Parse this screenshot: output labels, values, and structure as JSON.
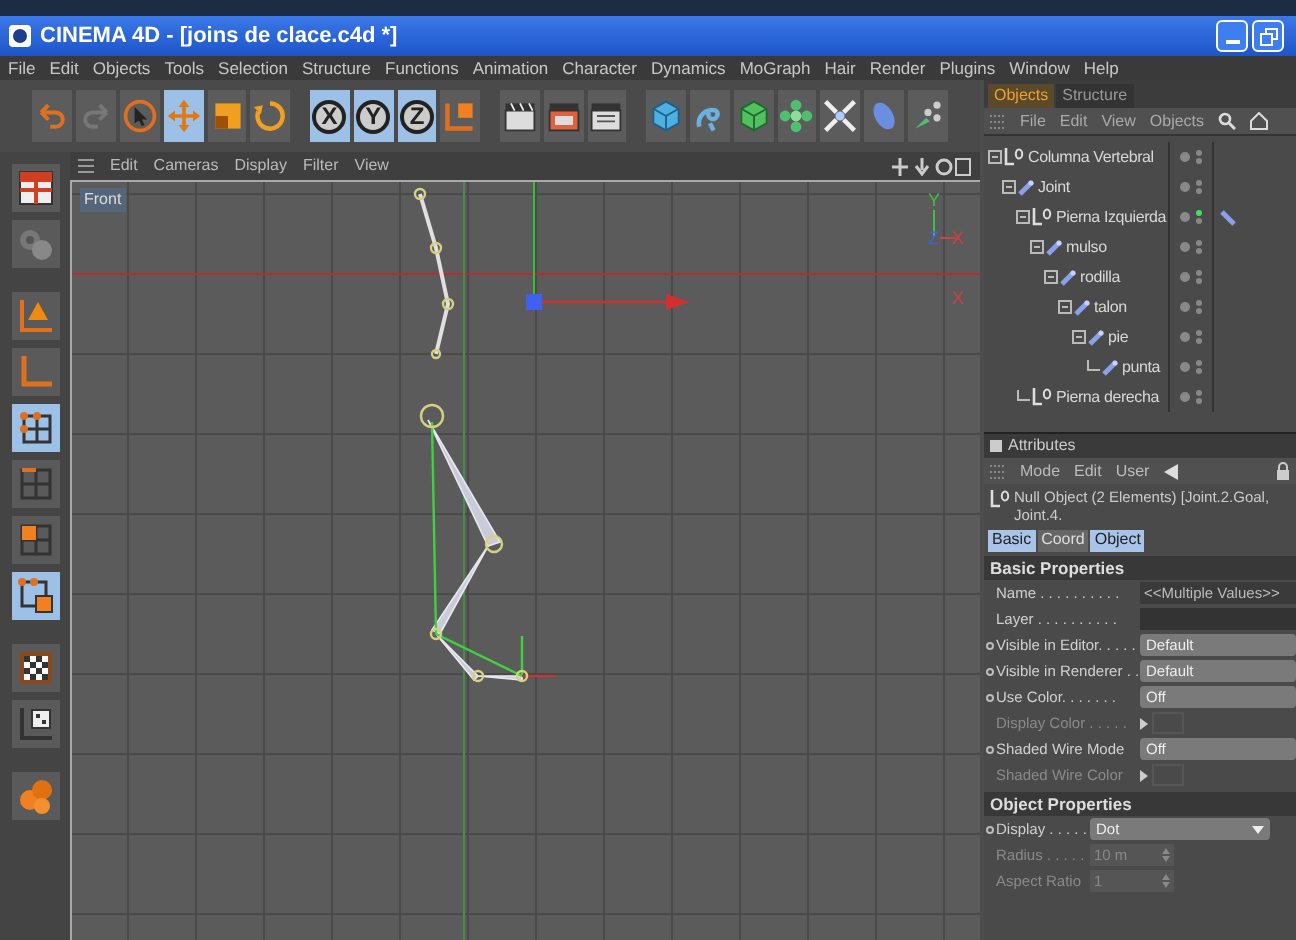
{
  "window": {
    "title": "CINEMA 4D - [joins de clace.c4d *]"
  },
  "menu_bar": [
    "File",
    "Edit",
    "Objects",
    "Tools",
    "Selection",
    "Structure",
    "Functions",
    "Animation",
    "Character",
    "Dynamics",
    "MoGraph",
    "Hair",
    "Render",
    "Plugins",
    "Window",
    "Help"
  ],
  "toolbar": [
    {
      "kind": "undo",
      "selected": false
    },
    {
      "kind": "redo",
      "selected": false
    },
    {
      "kind": "live-select",
      "selected": false
    },
    {
      "kind": "move",
      "selected": true
    },
    {
      "kind": "scale",
      "selected": false
    },
    {
      "kind": "rotate",
      "selected": false
    },
    {
      "kind": "axis",
      "label": "X",
      "selected": true
    },
    {
      "kind": "axis",
      "label": "Y",
      "selected": true
    },
    {
      "kind": "axis",
      "label": "Z",
      "selected": true
    },
    {
      "kind": "coord",
      "selected": false
    },
    {
      "kind": "render-view",
      "selected": false
    },
    {
      "kind": "render-active",
      "selected": false
    },
    {
      "kind": "render-settings",
      "selected": false
    },
    {
      "kind": "cube",
      "selected": false
    },
    {
      "kind": "spline",
      "selected": false
    },
    {
      "kind": "nurbs",
      "selected": false
    },
    {
      "kind": "array",
      "selected": false
    },
    {
      "kind": "deformer",
      "selected": false
    },
    {
      "kind": "light",
      "selected": false
    },
    {
      "kind": "particles",
      "selected": false
    }
  ],
  "left_toolbar": [
    {
      "kind": "layout",
      "selected": false
    },
    {
      "kind": "gear",
      "selected": false
    },
    {
      "kind": "object-axis",
      "selected": false
    },
    {
      "kind": "axis",
      "selected": false
    },
    {
      "kind": "points",
      "selected": true
    },
    {
      "kind": "edges",
      "selected": false
    },
    {
      "kind": "polygons",
      "selected": false
    },
    {
      "kind": "uv",
      "selected": true
    },
    {
      "kind": "texture",
      "selected": false
    },
    {
      "kind": "texture-axis",
      "selected": false
    },
    {
      "kind": "sculpt",
      "selected": false
    }
  ],
  "viewport": {
    "menu": [
      "Edit",
      "Cameras",
      "Display",
      "Filter",
      "View"
    ],
    "camera": "Front",
    "axis_labels": [
      "Y",
      "Z",
      "X",
      "X"
    ]
  },
  "objects_panel": {
    "tabs": [
      {
        "label": "Objects",
        "selected": true
      },
      {
        "label": "Structure",
        "selected": false
      }
    ],
    "menu": [
      "File",
      "Edit",
      "View",
      "Objects"
    ],
    "tree": [
      {
        "name": "Columna Vertebral",
        "kind": "null",
        "active": false,
        "tagged": false,
        "children": [
          {
            "name": "Joint",
            "kind": "joint",
            "active": false,
            "tagged": false,
            "children": [
              {
                "name": "Pierna Izquierda",
                "kind": "null",
                "active": true,
                "tagged": true,
                "children": [
                  {
                    "name": "mulso",
                    "kind": "joint",
                    "active": false,
                    "tagged": false,
                    "children": [
                      {
                        "name": "rodilla",
                        "kind": "joint",
                        "active": false,
                        "tagged": false,
                        "children": [
                          {
                            "name": "talon",
                            "kind": "joint",
                            "active": false,
                            "tagged": false,
                            "children": [
                              {
                                "name": "pie",
                                "kind": "joint",
                                "active": false,
                                "tagged": false,
                                "children": [
                                  {
                                    "name": "punta",
                                    "kind": "joint",
                                    "active": false,
                                    "tagged": false
                                  }
                                ]
                              }
                            ]
                          }
                        ]
                      }
                    ]
                  }
                ]
              },
              {
                "name": "Pierna derecha",
                "kind": "null",
                "active": false,
                "tagged": false
              }
            ]
          }
        ]
      }
    ]
  },
  "attributes": {
    "title": "Attributes",
    "menu": [
      "Mode",
      "Edit",
      "User"
    ],
    "object": "Null Object (2 Elements) [Joint.2.Goal, Joint.4.",
    "tabs": [
      {
        "label": "Basic",
        "selected": true
      },
      {
        "label": "Coord",
        "selected": false
      },
      {
        "label": "Object",
        "selected": true
      }
    ],
    "sections": [
      {
        "title": "Basic Properties",
        "rows": [
          {
            "label": "Name . . . . . . . . . .",
            "kind": "text",
            "value": "<<Multiple Values>>",
            "disabled": false,
            "keyed": false
          },
          {
            "label": "Layer . . . . . . . . . .",
            "kind": "link",
            "disabled": false,
            "keyed": false
          },
          {
            "label": "Visible in Editor. . . . .",
            "kind": "cycle",
            "value": "Default",
            "disabled": false,
            "keyed": true
          },
          {
            "label": "Visible in Renderer . .",
            "kind": "cycle",
            "value": "Default",
            "disabled": false,
            "keyed": true
          },
          {
            "label": "Use Color. . . . . . .",
            "kind": "cycle",
            "value": "Off",
            "disabled": false,
            "keyed": true
          },
          {
            "label": "Display Color . . . . .",
            "kind": "color",
            "disabled": true,
            "keyed": false
          },
          {
            "label": "Shaded Wire Mode",
            "kind": "cycle",
            "value": "Off",
            "disabled": false,
            "keyed": true
          },
          {
            "label": "Shaded Wire Color",
            "kind": "color",
            "disabled": true,
            "keyed": false
          }
        ]
      },
      {
        "title": "Object Properties",
        "rows": [
          {
            "label": "Display . . . . .",
            "kind": "dropdown",
            "value": "Dot",
            "disabled": false,
            "keyed": true
          },
          {
            "label": "Radius . . . . .",
            "kind": "number",
            "value": "10 m",
            "disabled": true,
            "keyed": false
          },
          {
            "label": "Aspect Ratio",
            "kind": "number",
            "value": "1",
            "disabled": true,
            "keyed": false
          }
        ]
      }
    ]
  }
}
